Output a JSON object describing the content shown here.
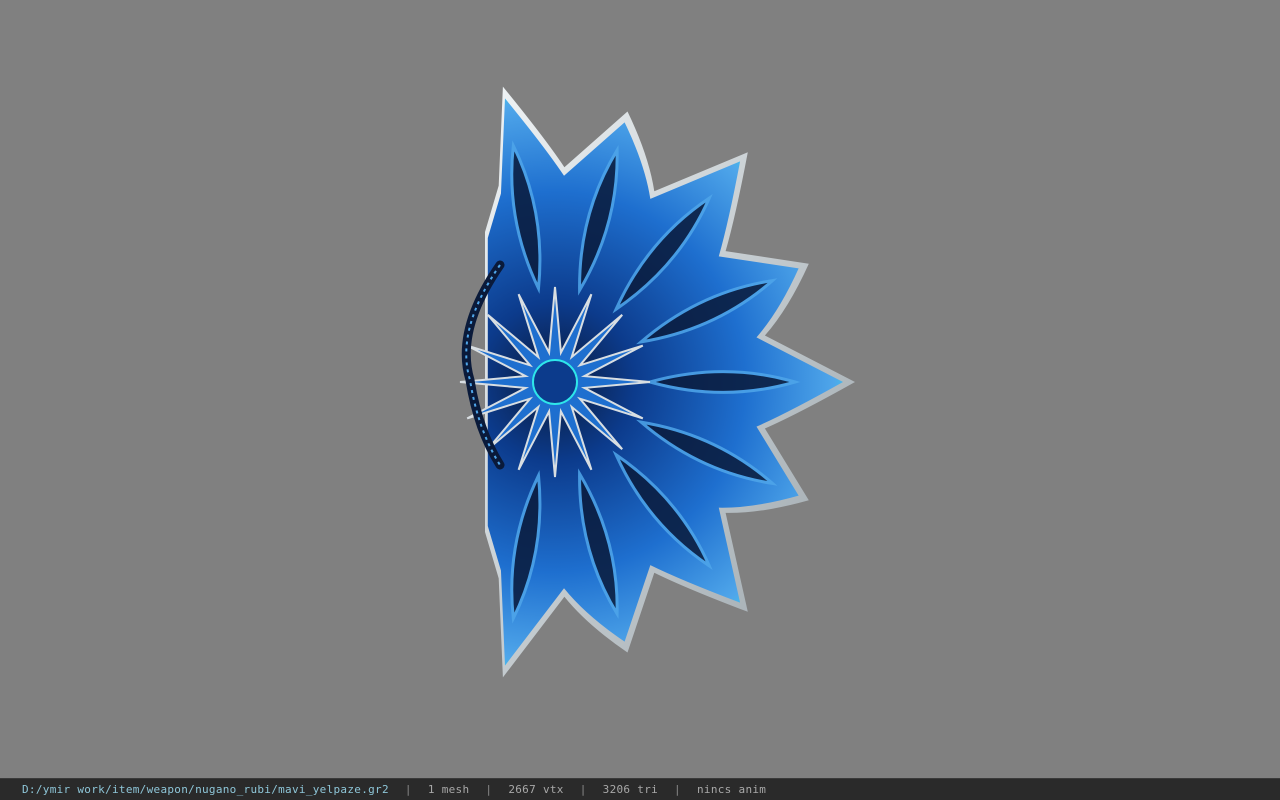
{
  "viewer": {
    "background_color": "#808080",
    "model_palette": {
      "deep_blue": "#0c3b8c",
      "mid_blue": "#1e6fcf",
      "light_blue": "#4fa6ea",
      "cyan_glow": "#2ee6ea",
      "edge_silver": "#d8dee2",
      "shadow_navy": "#0a1a3a"
    },
    "model_name": "fan-shaped blue weapon mesh"
  },
  "status_bar": {
    "file_path": "D:/ymir work/item/weapon/nugano_rubi/mavi_yelpaze.gr2",
    "mesh_count": "1 mesh",
    "vertex_count": "2667 vtx",
    "triangle_count": "3206 tri",
    "animation": "nincs anim",
    "separator": "|"
  }
}
